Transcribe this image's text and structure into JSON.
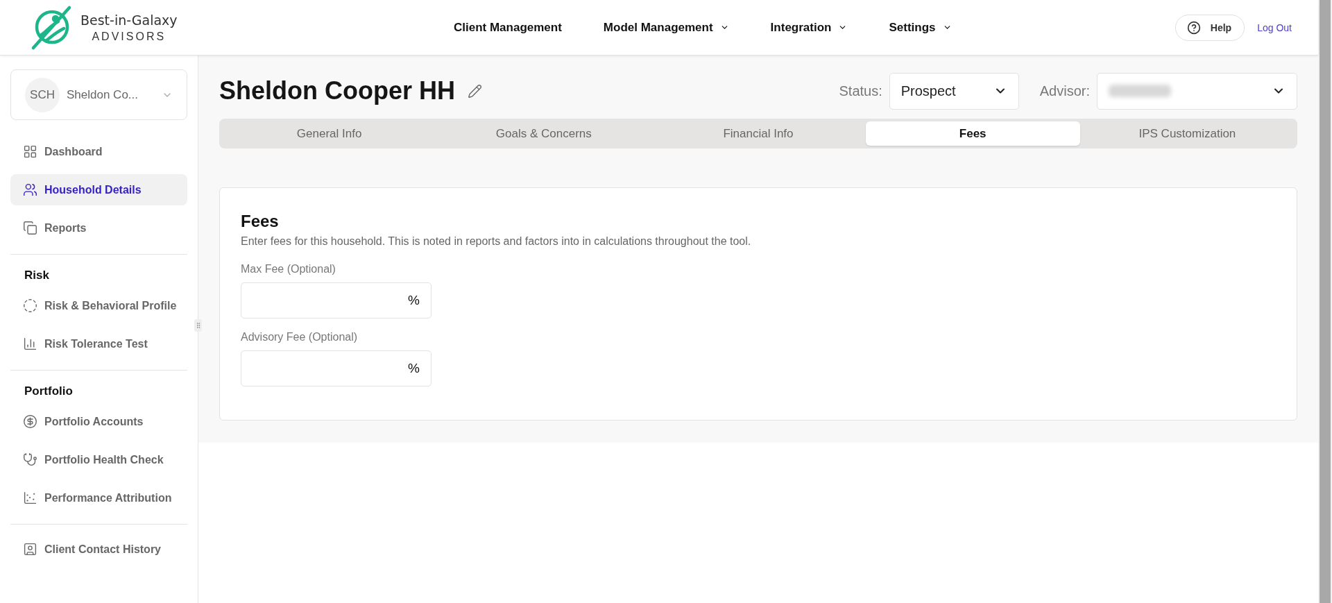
{
  "header": {
    "logo": {
      "name": "Best-in-Galaxy",
      "tagline": "ADVISORS"
    },
    "nav": [
      {
        "label": "Client Management",
        "has_menu": false
      },
      {
        "label": "Model Management",
        "has_menu": true
      },
      {
        "label": "Integration",
        "has_menu": true
      },
      {
        "label": "Settings",
        "has_menu": true
      }
    ],
    "help": "Help",
    "logout": "Log Out"
  },
  "sidebar": {
    "account": {
      "initials": "SCH",
      "name": "Sheldon Co..."
    },
    "sections": [
      {
        "items": [
          {
            "label": "Dashboard",
            "selected": false
          },
          {
            "label": "Household Details",
            "selected": true
          },
          {
            "label": "Reports",
            "selected": false
          }
        ]
      },
      {
        "heading": "Risk",
        "items": [
          {
            "label": "Risk & Behavioral Profile",
            "selected": false
          },
          {
            "label": "Risk Tolerance Test",
            "selected": false
          }
        ]
      },
      {
        "heading": "Portfolio",
        "items": [
          {
            "label": "Portfolio Accounts",
            "selected": false
          },
          {
            "label": "Portfolio Health Check",
            "selected": false
          },
          {
            "label": "Performance Attribution",
            "selected": false
          }
        ]
      },
      {
        "items": [
          {
            "label": "Client Contact History",
            "selected": false
          }
        ]
      }
    ]
  },
  "page": {
    "title": "Sheldon Cooper HH",
    "status": {
      "label": "Status:",
      "value": "Prospect"
    },
    "advisor": {
      "label": "Advisor:",
      "redacted": true
    },
    "tabs": [
      {
        "label": "General Info",
        "selected": false
      },
      {
        "label": "Goals & Concerns",
        "selected": false
      },
      {
        "label": "Financial Info",
        "selected": false
      },
      {
        "label": "Fees",
        "selected": true
      },
      {
        "label": "IPS Customization",
        "selected": false
      }
    ],
    "card": {
      "title": "Fees",
      "description": "Enter fees for this household. This is noted in reports and factors into in calculations throughout the tool.",
      "fields": [
        {
          "label": "Max Fee (Optional)",
          "unit": "%"
        },
        {
          "label": "Advisory Fee (Optional)",
          "unit": "%"
        }
      ]
    }
  }
}
